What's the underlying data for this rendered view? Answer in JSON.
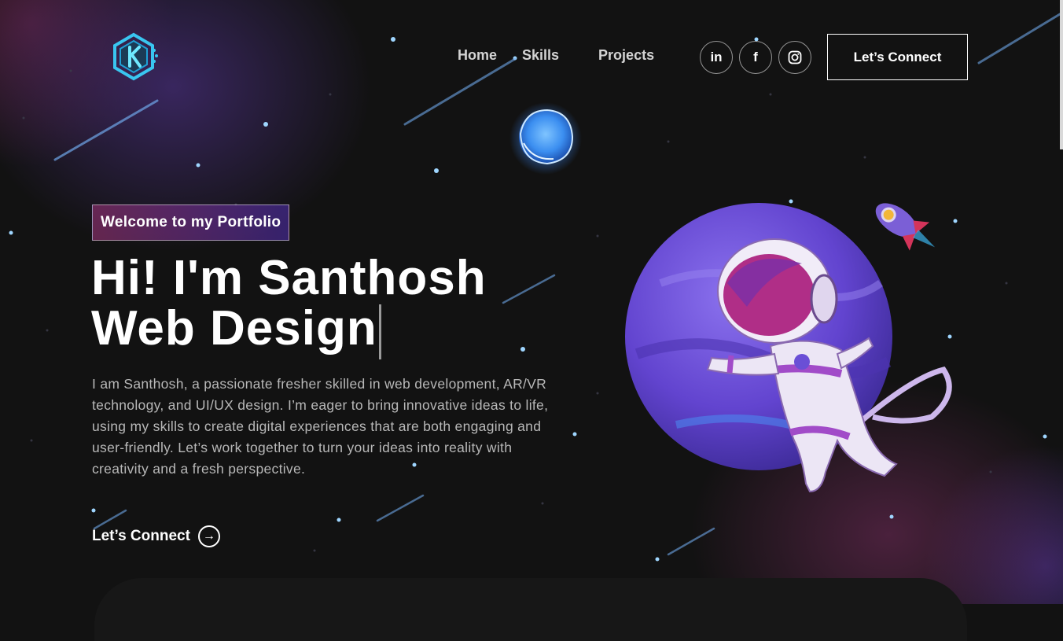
{
  "nav": {
    "items": [
      "Home",
      "Skills",
      "Projects"
    ]
  },
  "social": {
    "linkedin": "in",
    "facebook": "f",
    "instagram_icon": "instagram-icon"
  },
  "header_button": "Let’s Connect",
  "hero": {
    "tagline": "Welcome to my Portfolio",
    "headline_line1": "Hi! I'm Santhosh",
    "headline_line2": "Web Design",
    "intro": "I am Santhosh, a passionate fresher skilled in web development, AR/VR technology, and UI/UX design. I’m eager to bring innovative ideas to life, using my skills to create digital experiences that are both engaging and user-friendly. Let’s work together to turn your ideas into reality with creativity and a fresh perspective.",
    "cta": "Let’s Connect"
  },
  "colors": {
    "background": "#121212",
    "tag_gradient_start": "#aa367c",
    "tag_gradient_end": "#4a2fbd",
    "planet": "#6a4fd6",
    "logo": "#39c6f0"
  }
}
